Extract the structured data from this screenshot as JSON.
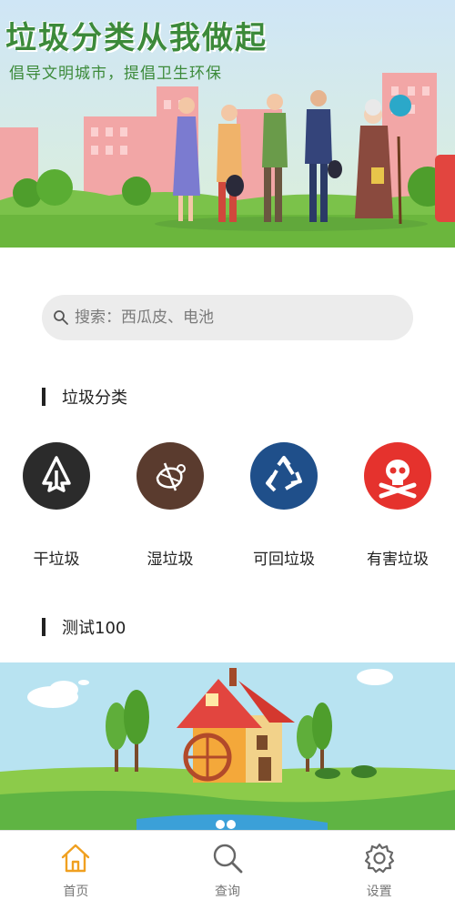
{
  "banner": {
    "title": "垃圾分类从我做起",
    "subtitle": "倡导文明城市，提倡卫生环保"
  },
  "search": {
    "placeholder": "搜索：西瓜皮、电池"
  },
  "sections": {
    "categories_title": "垃圾分类",
    "test_title": "测试100"
  },
  "categories": [
    {
      "label": "干垃圾",
      "color": "#2b2b2b",
      "icon": "dry-waste-icon"
    },
    {
      "label": "湿垃圾",
      "color": "#5a3b2e",
      "icon": "wet-waste-icon"
    },
    {
      "label": "可回垃圾",
      "color": "#1f4f8a",
      "icon": "recycle-icon"
    },
    {
      "label": "有害垃圾",
      "color": "#e5322d",
      "icon": "hazard-skull-icon"
    }
  ],
  "nav": [
    {
      "label": "首页",
      "icon": "home-icon",
      "active": true,
      "color": "#f0a020"
    },
    {
      "label": "查询",
      "icon": "search-icon",
      "active": false,
      "color": "#666666"
    },
    {
      "label": "设置",
      "icon": "gear-icon",
      "active": false,
      "color": "#666666"
    }
  ]
}
